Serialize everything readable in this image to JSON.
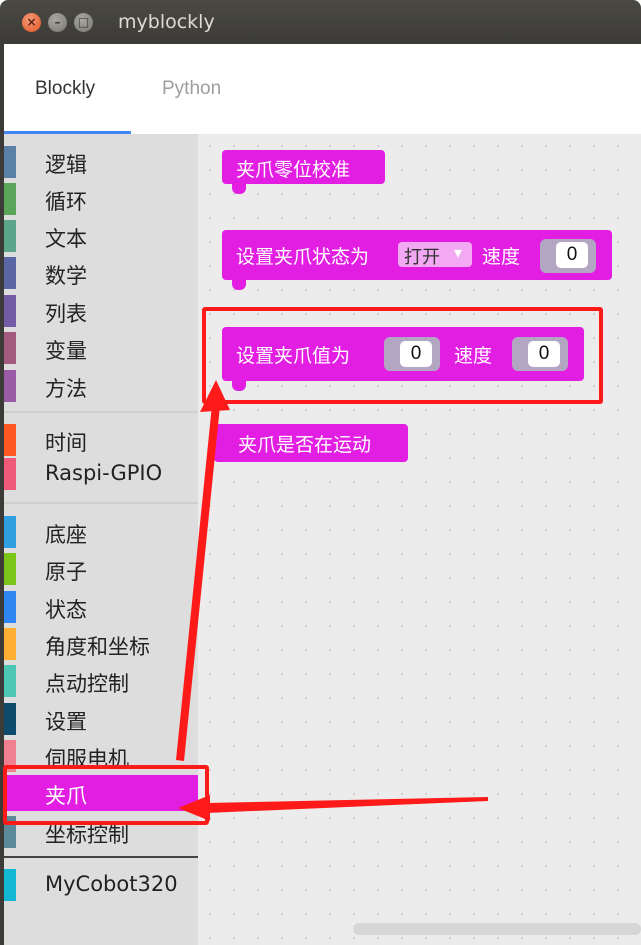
{
  "window": {
    "title": "myblockly",
    "close_glyph": "×",
    "min_glyph": "–",
    "max_glyph": "□"
  },
  "tabs": [
    {
      "label": "Blockly",
      "active": true
    },
    {
      "label": "Python",
      "active": false
    }
  ],
  "toolbox": {
    "groups": [
      [
        {
          "label": "逻辑",
          "color": "#5b80a5"
        },
        {
          "label": "循环",
          "color": "#5ba55b"
        },
        {
          "label": "文本",
          "color": "#5ba58c"
        },
        {
          "label": "数学",
          "color": "#5b67a5"
        },
        {
          "label": "列表",
          "color": "#745ba5"
        },
        {
          "label": "变量",
          "color": "#a55b80"
        },
        {
          "label": "方法",
          "color": "#995ba5"
        }
      ],
      [
        {
          "label": "时间",
          "color": "#ff5722"
        },
        {
          "label": "Raspi-GPIO",
          "color": "#ef5a7a"
        }
      ],
      [
        {
          "label": "底座",
          "color": "#2f9fe0"
        },
        {
          "label": "原子",
          "color": "#7bc41a"
        },
        {
          "label": "状态",
          "color": "#2f86f2"
        },
        {
          "label": "角度和坐标",
          "color": "#ffb033"
        },
        {
          "label": "点动控制",
          "color": "#4ec6b4"
        },
        {
          "label": "设置",
          "color": "#0d4a6b"
        },
        {
          "label": "伺服电机",
          "color": "#f08090"
        },
        {
          "label": "夹爪",
          "color": "#e31ee3",
          "selected": true
        },
        {
          "label": "坐标控制",
          "color": "#5c8a9a"
        }
      ],
      [
        {
          "label": "MyCobot320",
          "color": "#14b8d4"
        }
      ]
    ]
  },
  "blocks": {
    "calibrate": {
      "label": "夹爪零位校准"
    },
    "set_state": {
      "label": "设置夹爪状态为",
      "dropdown_value": "打开",
      "dropdown_arrow": "▾",
      "speed_label": "速度",
      "speed_value": "0"
    },
    "set_value": {
      "label": "设置夹爪值为",
      "value": "0",
      "speed_label": "速度",
      "speed_value": "0"
    },
    "is_moving": {
      "label": "夹爪是否在运动"
    }
  },
  "colors": {
    "gripper_block": "#e31ee3",
    "annotation_red": "#ff1a1a",
    "tab_underline": "#4285f4"
  }
}
